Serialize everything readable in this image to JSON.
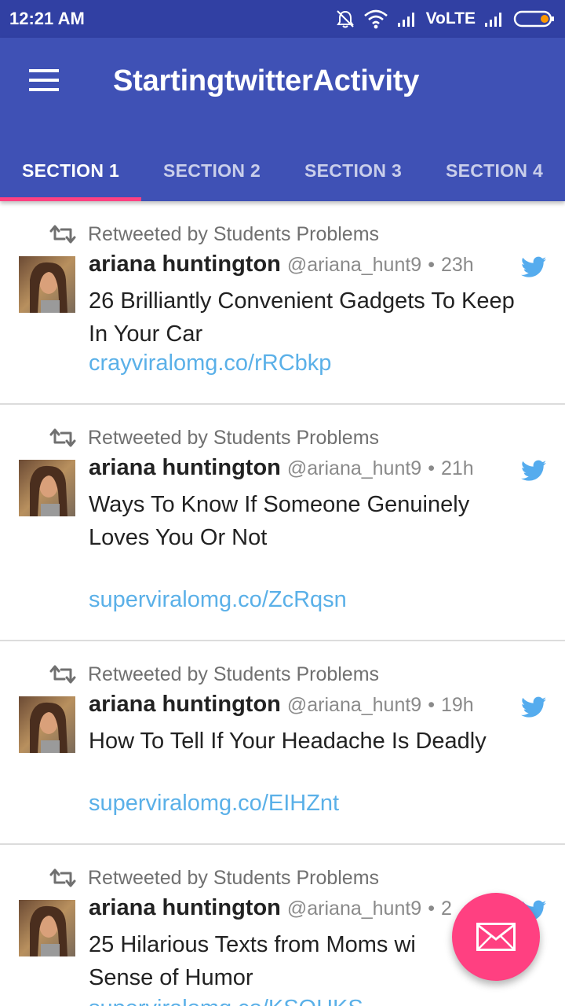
{
  "status_bar": {
    "time": "12:21 AM",
    "network_label": "VoLTE",
    "icons": [
      "alarm-off-icon",
      "wifi-icon",
      "signal-icon",
      "signal-icon",
      "battery-icon"
    ],
    "battery_color": "#ff9800"
  },
  "app_bar": {
    "title": "StartingtwitterActivity",
    "menu_icon": "hamburger-menu-icon",
    "color": "#3f51b5"
  },
  "tabs": [
    {
      "label": "SECTION 1",
      "active": true
    },
    {
      "label": "SECTION 2",
      "active": false
    },
    {
      "label": "SECTION 3",
      "active": false
    },
    {
      "label": "SECTION 4",
      "active": false
    }
  ],
  "tweets": [
    {
      "retweet_label": "Retweeted by Students Problems",
      "name": "ariana huntington",
      "handle": "@ariana_hunt9",
      "separator": "•",
      "time": "23h",
      "text": "26 Brilliantly Convenient Gadgets To Keep In Your Car",
      "link": "crayviralomg.co/rRCbkp"
    },
    {
      "retweet_label": "Retweeted by Students Problems",
      "name": "ariana huntington",
      "handle": "@ariana_hunt9",
      "separator": "•",
      "time": "21h",
      "text": "Ways To Know If Someone Genuinely Loves You Or Not",
      "link": "superviralomg.co/ZcRqsn"
    },
    {
      "retweet_label": "Retweeted by Students Problems",
      "name": "ariana huntington",
      "handle": "@ariana_hunt9",
      "separator": "•",
      "time": "19h",
      "text": "How To Tell If Your Headache Is Deadly",
      "link": "superviralomg.co/EIHZnt"
    },
    {
      "retweet_label": "Retweeted by Students Problems",
      "name": "ariana huntington",
      "handle": "@ariana_hunt9",
      "separator": "•",
      "time": "2",
      "text": "25 Hilarious Texts from Moms wi",
      "text_line2": "Sense of Humor",
      "link": "superviralomg.co/KSOHKS"
    }
  ],
  "fab": {
    "icon": "mail-icon",
    "color": "#ff4081"
  },
  "colors": {
    "accent": "#ff4081",
    "link": "#5ab0e8",
    "twitter_blue": "#55acee",
    "status_bar": "#3140a3"
  }
}
